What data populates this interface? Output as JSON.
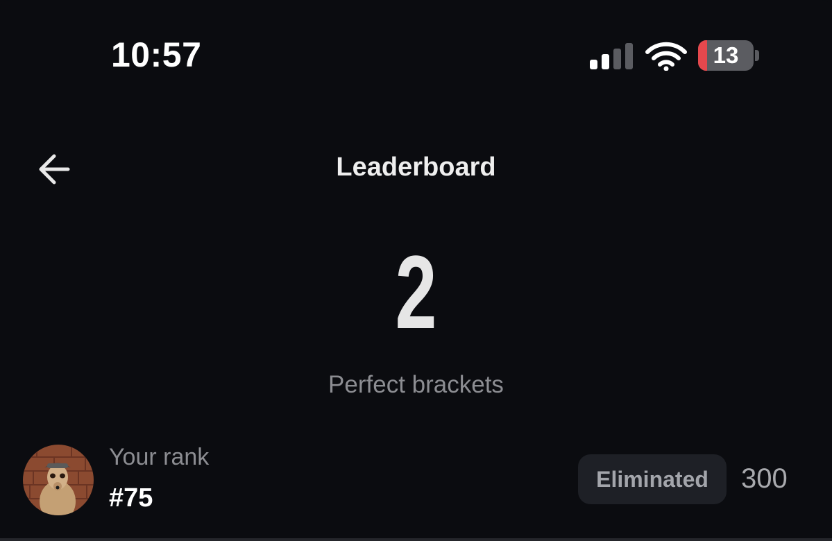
{
  "status_bar": {
    "time": "10:57",
    "cell_signal_bars_active": 2,
    "cell_signal_bars_total": 4,
    "battery_level": "13",
    "battery_low_color": "#e5484d"
  },
  "header": {
    "back_icon": "arrow-left-icon",
    "title": "Leaderboard"
  },
  "summary": {
    "perfect_brackets_count": "2",
    "perfect_brackets_label": "Perfect brackets"
  },
  "your_rank": {
    "caption": "Your rank",
    "rank": "#75",
    "status": "Eliminated",
    "score": "300"
  },
  "colors": {
    "background": "#0b0c10",
    "badge_background": "#1e2026",
    "muted_text": "#8c8d92"
  }
}
